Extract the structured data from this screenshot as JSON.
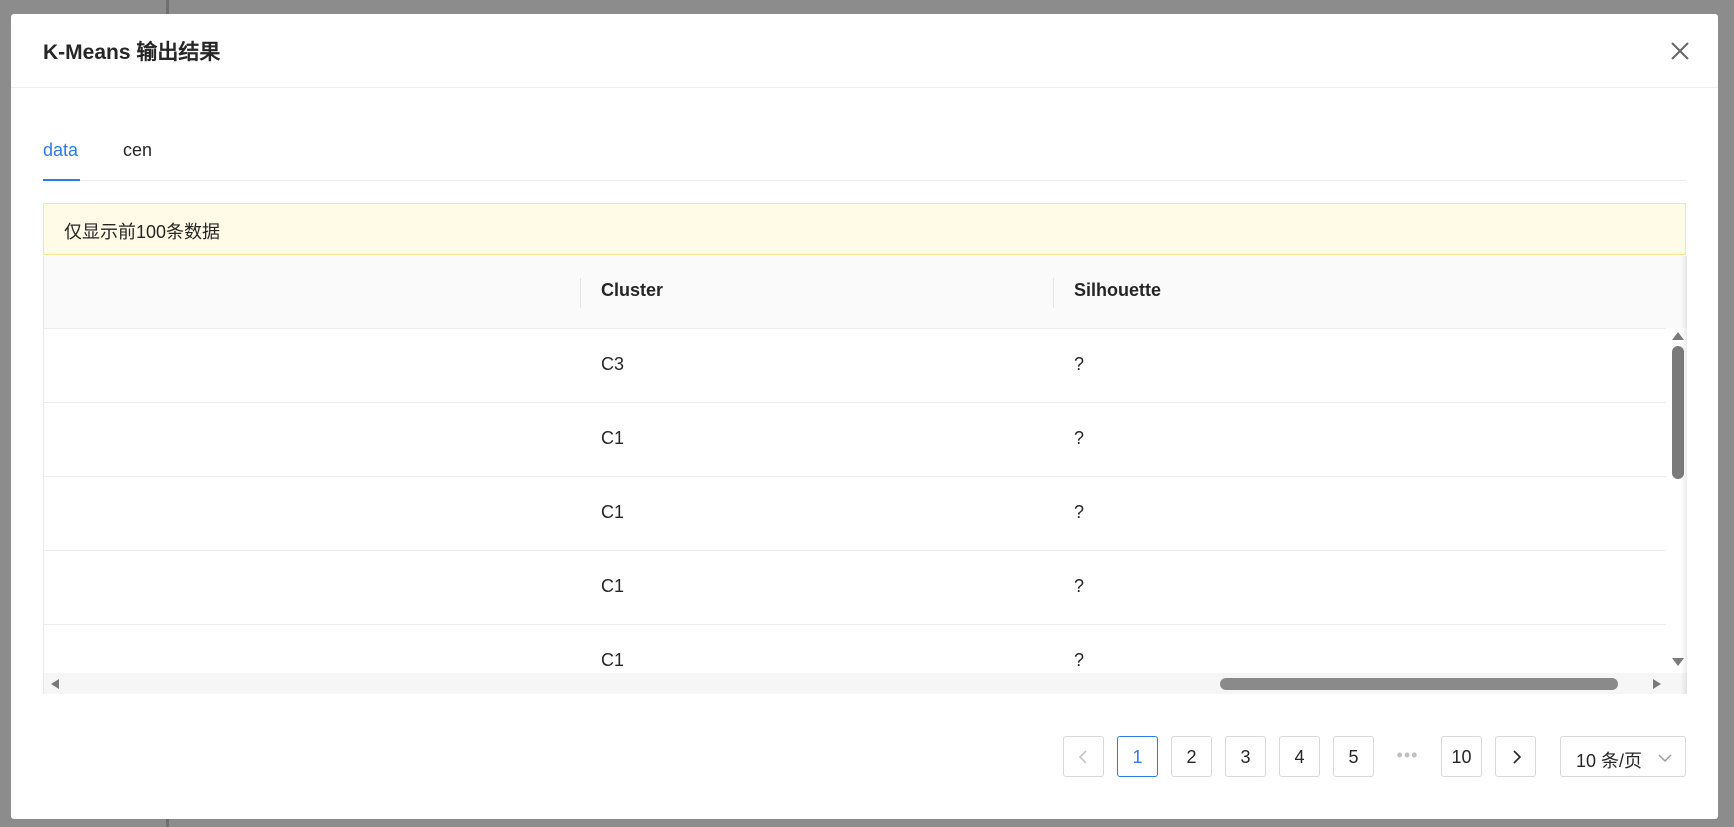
{
  "modal": {
    "title": "K-Means 输出结果"
  },
  "tabs": [
    {
      "label": "data",
      "active": true
    },
    {
      "label": "cen",
      "active": false
    }
  ],
  "alert": {
    "text": "仅显示前100条数据"
  },
  "table": {
    "columns": [
      "",
      "Cluster",
      "Silhouette"
    ],
    "rows": [
      [
        "",
        "C3",
        "?"
      ],
      [
        "",
        "C1",
        "?"
      ],
      [
        "",
        "C1",
        "?"
      ],
      [
        "",
        "C1",
        "?"
      ],
      [
        "",
        "C1",
        "?"
      ]
    ]
  },
  "pagination": {
    "pages": [
      "1",
      "2",
      "3",
      "4",
      "5"
    ],
    "ellipsis": "•••",
    "last_page": "10",
    "current": "1",
    "page_size": "10 条/页"
  },
  "colors": {
    "accent": "#2e7ae6",
    "alert_bg": "#fffbe6",
    "alert_border": "#ffe58f"
  },
  "icons": {
    "close": "close-icon",
    "prev": "chevron-left-icon",
    "next": "chevron-right-icon",
    "dropdown": "chevron-down-icon"
  }
}
